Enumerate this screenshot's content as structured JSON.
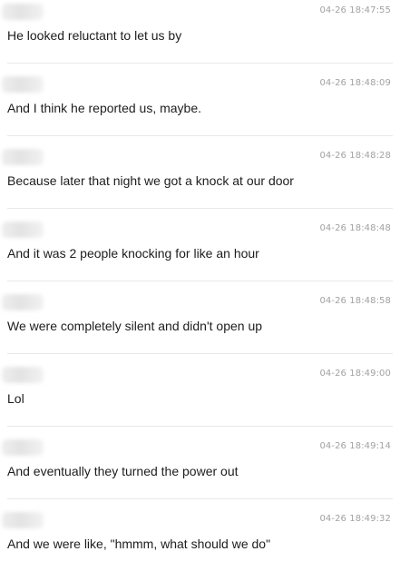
{
  "messages": [
    {
      "timestamp": "04-26 18:47:55",
      "text": "He looked reluctant to let us by"
    },
    {
      "timestamp": "04-26 18:48:09",
      "text": "And I think he reported us, maybe."
    },
    {
      "timestamp": "04-26 18:48:28",
      "text": "Because later that night we got a knock at our door"
    },
    {
      "timestamp": "04-26 18:48:48",
      "text": "And it was 2 people knocking for like an hour"
    },
    {
      "timestamp": "04-26 18:48:58",
      "text": "We were completely silent and didn't open up"
    },
    {
      "timestamp": "04-26 18:49:00",
      "text": "Lol"
    },
    {
      "timestamp": "04-26 18:49:14",
      "text": "And eventually they turned the power out"
    },
    {
      "timestamp": "04-26 18:49:32",
      "text": "And we were like, \"hmmm, what should we do\""
    }
  ]
}
